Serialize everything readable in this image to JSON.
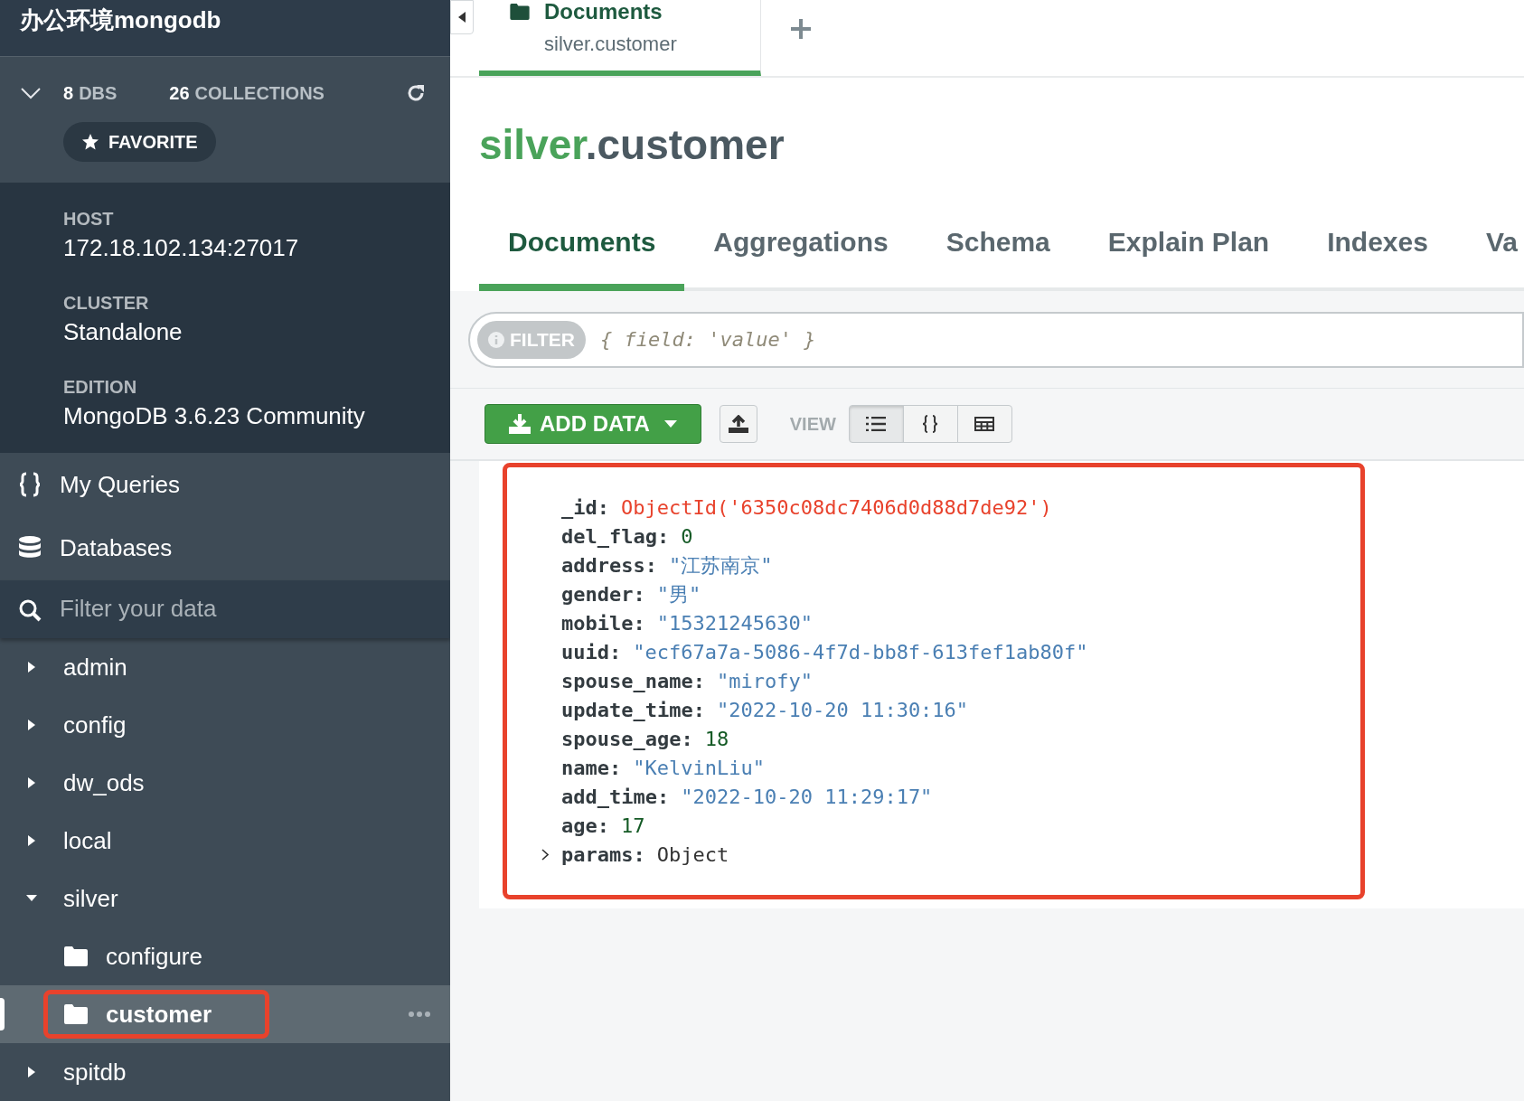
{
  "sidebar": {
    "title": "办公环境mongodb",
    "stats": {
      "dbs_count": "8",
      "dbs_label": "DBS",
      "collections_count": "26",
      "collections_label": "COLLECTIONS",
      "expanded": true
    },
    "favorite_button": "FAVORITE",
    "info": [
      {
        "label": "HOST",
        "value": "172.18.102.134:27017"
      },
      {
        "label": "CLUSTER",
        "value": "Standalone"
      },
      {
        "label": "EDITION",
        "value": "MongoDB 3.6.23 Community"
      }
    ],
    "nav": [
      {
        "label": "My Queries",
        "kind": "queries"
      },
      {
        "label": "Databases",
        "kind": "databases"
      }
    ],
    "filter": {
      "placeholder": "Filter your data"
    },
    "tree": [
      {
        "label": "admin",
        "expanded": false
      },
      {
        "label": "config",
        "expanded": false
      },
      {
        "label": "dw_ods",
        "expanded": false
      },
      {
        "label": "local",
        "expanded": false
      },
      {
        "label": "silver",
        "expanded": true,
        "children": [
          {
            "label": "configure",
            "selected": false,
            "annotated": false
          },
          {
            "label": "customer",
            "selected": true,
            "annotated": true
          }
        ]
      },
      {
        "label": "spitdb",
        "expanded": false
      }
    ]
  },
  "workspace_tabs": [
    {
      "title": "Documents",
      "subtitle": "silver.customer",
      "selected": true
    }
  ],
  "collection_title": {
    "database": "silver",
    "rest": ".customer"
  },
  "tabs": [
    {
      "label": "Documents",
      "selected": true
    },
    {
      "label": "Aggregations",
      "selected": false
    },
    {
      "label": "Schema",
      "selected": false
    },
    {
      "label": "Explain Plan",
      "selected": false
    },
    {
      "label": "Indexes",
      "selected": false
    },
    {
      "label": "Va",
      "selected": false
    }
  ],
  "filter": {
    "button": "FILTER",
    "placeholder": "{ field: 'value' }"
  },
  "toolbar": {
    "add_data": "ADD DATA",
    "view_label": "VIEW",
    "views": [
      {
        "kind": "list",
        "selected": true
      },
      {
        "kind": "json",
        "selected": false
      },
      {
        "kind": "table",
        "selected": false
      }
    ]
  },
  "document": {
    "annotated": true,
    "fields": [
      {
        "key": "_id:",
        "value": "ObjectId('6350c08dc7406d0d88d7de92')",
        "kind": "objectid"
      },
      {
        "key": "del_flag:",
        "value": "0",
        "kind": "number"
      },
      {
        "key": "address:",
        "value": "\"江苏南京\"",
        "kind": "string"
      },
      {
        "key": "gender:",
        "value": "\"男\"",
        "kind": "string"
      },
      {
        "key": "mobile:",
        "value": "\"15321245630\"",
        "kind": "string"
      },
      {
        "key": "uuid:",
        "value": "\"ecf67a7a-5086-4f7d-bb8f-613fef1ab80f\"",
        "kind": "string"
      },
      {
        "key": "spouse_name:",
        "value": "\"mirofy\"",
        "kind": "string"
      },
      {
        "key": "update_time:",
        "value": "\"2022-10-20 11:30:16\"",
        "kind": "string"
      },
      {
        "key": "spouse_age:",
        "value": "18",
        "kind": "number"
      },
      {
        "key": "name:",
        "value": "\"KelvinLiu\"",
        "kind": "string"
      },
      {
        "key": "add_time:",
        "value": "\"2022-10-20 11:29:17\"",
        "kind": "string"
      },
      {
        "key": "age:",
        "value": "17",
        "kind": "number"
      },
      {
        "key": "params:",
        "value": "Object",
        "kind": "object",
        "expanded": false
      }
    ]
  }
}
